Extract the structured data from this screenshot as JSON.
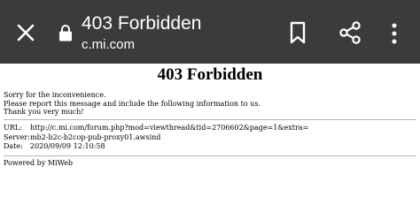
{
  "header": {
    "title": "403 Forbidden",
    "url": "c.mi.com",
    "background_color": "#3b3b3b",
    "icons": {
      "close": "close-icon",
      "lock": "lock-icon",
      "bookmark": "bookmark-icon",
      "share": "share-icon",
      "more": "more-vert-icon"
    }
  },
  "page": {
    "heading": "403 Forbidden",
    "message_lines": [
      "Sorry for the inconvenience.",
      "Please report this message and include the following information to us.",
      "Thank you very much!"
    ],
    "info": [
      {
        "label": "URL:",
        "value": "http://c.mi.com/forum.php?mod=viewthread&tid=2706602&page=1&extra="
      },
      {
        "label": "Server:",
        "value": "mb2-b2c-b2cop-pub-proxy01.awsind"
      },
      {
        "label": "Date:",
        "value": "2020/09/09 12:10:58"
      }
    ],
    "powered_by": "Powered by MiWeb"
  }
}
